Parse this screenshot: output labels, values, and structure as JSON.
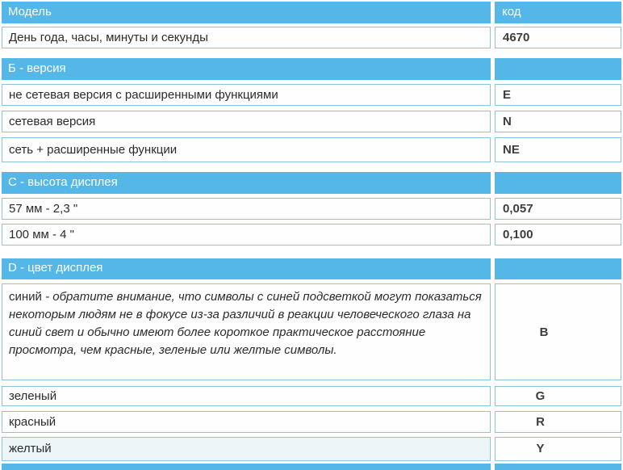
{
  "colors": {
    "section_bar_bg": "#54b7e8",
    "row_border": "#8ec3dc",
    "row_bg": "#fdfefd",
    "bar_text": "#ffffff",
    "label_text": "#2b2b2b",
    "code_text": "#3d3d3d",
    "code_strong_text": "#000000"
  },
  "header": {
    "model_label": "Модель",
    "code_label": "код"
  },
  "rows": [
    {
      "label": "День года, часы, минуты и секунды",
      "code": "4670"
    },
    {
      "label": "не сетевая версия с расширенными функциями",
      "code": "E"
    },
    {
      "label": "сетевая версия",
      "code": "N"
    },
    {
      "label": "сеть + расширенные функции",
      "code": "NE"
    },
    {
      "label": "57 мм - 2,3 \"",
      "code": "0,057"
    },
    {
      "label": "100 мм - 4 \"",
      "code": "0,100"
    },
    {
      "label": "зеленый",
      "code": "G"
    },
    {
      "label": "красный",
      "code": "R"
    },
    {
      "label": "желтый",
      "code": "Y"
    }
  ],
  "sections": [
    {
      "label": "Б - версия"
    },
    {
      "label": "C - высота дисплея"
    },
    {
      "label": "D - цвет дисплея"
    }
  ],
  "note": {
    "lead": "синий",
    "rest": " - обратите внимание, что символы с синей подсветкой могут показаться некоторым людям не в фокусе из-за различий в реакции человеческого глаза на синий свет и обычно имеют более короткое практическое расстояние просмотра, чем красные, зеленые или желтые символы.",
    "code": "B"
  }
}
